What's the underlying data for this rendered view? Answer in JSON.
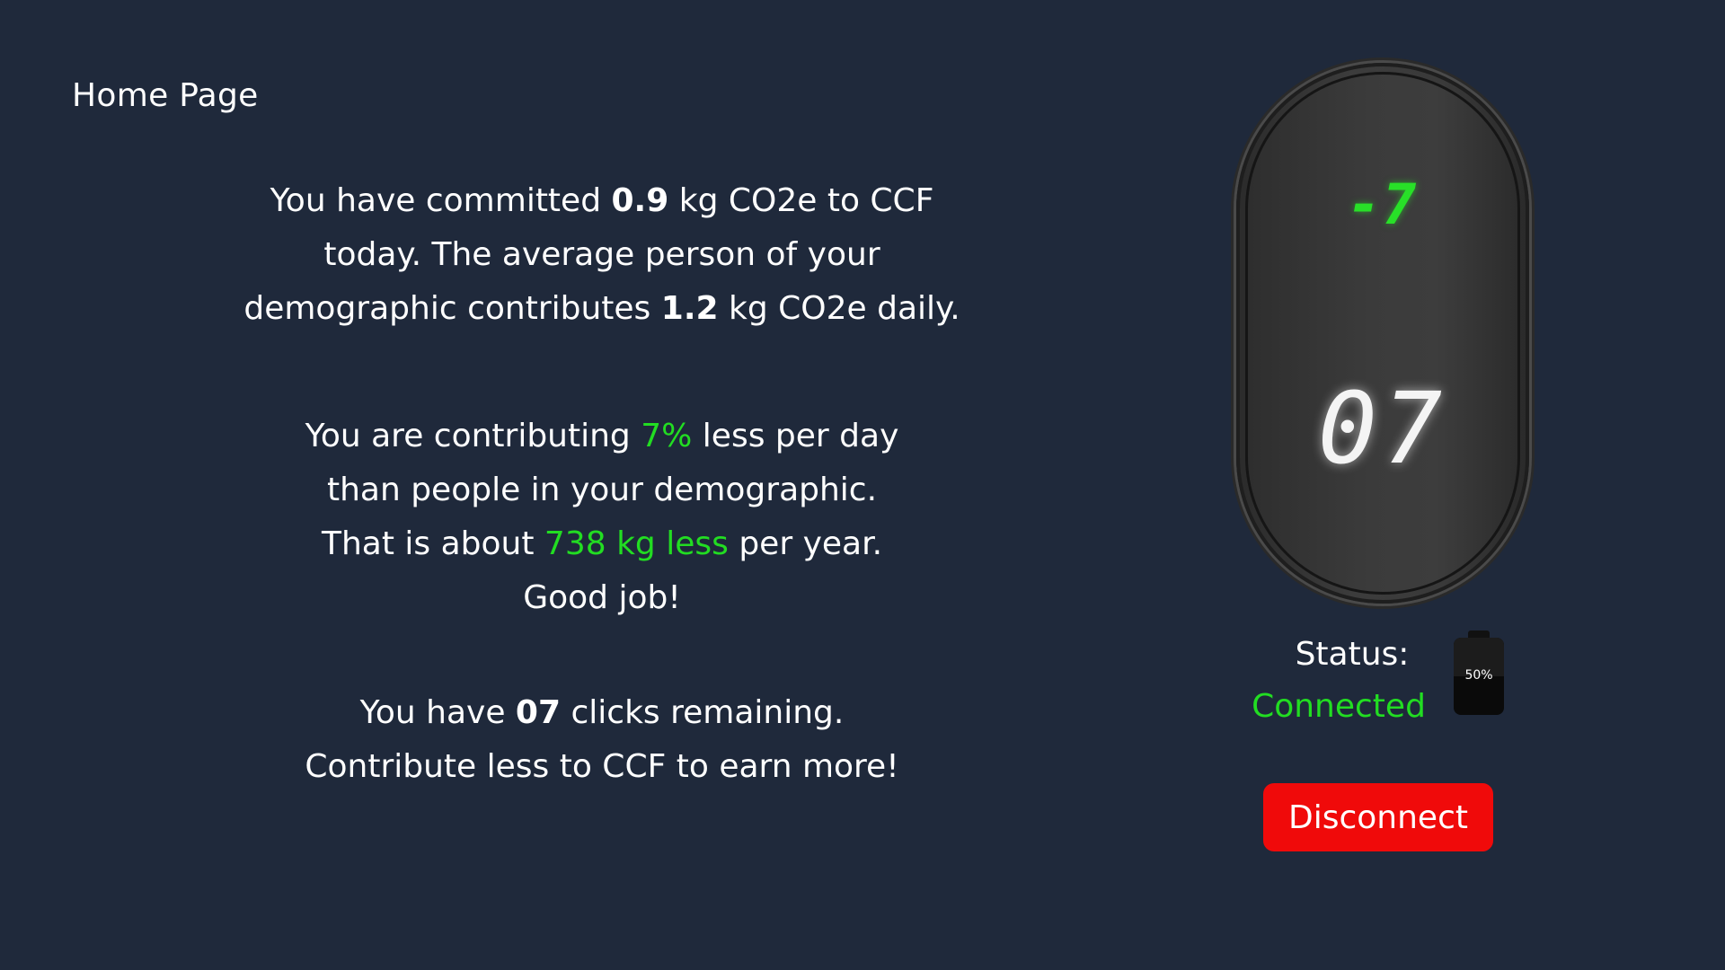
{
  "page": {
    "title": "Home Page"
  },
  "summary": {
    "line1_a": "You have committed ",
    "committed_value": "0.9",
    "line1_b": " kg CO2e to CCF",
    "line2": "today. The average person of your",
    "line3_a": "demographic contributes ",
    "average_value": "1.2",
    "line3_b": " kg CO2e daily."
  },
  "comparison": {
    "line1_a": "You are contributing ",
    "percent_less": "7%",
    "line1_b": " less per day",
    "line2": "than people in your demographic.",
    "line3_a": "That is about ",
    "yearly_less": "738 kg less",
    "line3_b": " per year.",
    "line4": "Good job!"
  },
  "clicks": {
    "line1_a": "You have ",
    "remaining": "07",
    "line1_b": " clicks remaining.",
    "line2": "Contribute less to CCF to earn more!"
  },
  "device": {
    "top_readout": "-7",
    "big_readout": "07"
  },
  "status": {
    "label": "Status:",
    "value": "Connected"
  },
  "battery": {
    "label": "50%",
    "level": 0.5
  },
  "actions": {
    "disconnect_label": "Disconnect"
  },
  "colors": {
    "background": "#1f293b",
    "accent_green": "#22dd22",
    "danger_red": "#f00a0a"
  }
}
